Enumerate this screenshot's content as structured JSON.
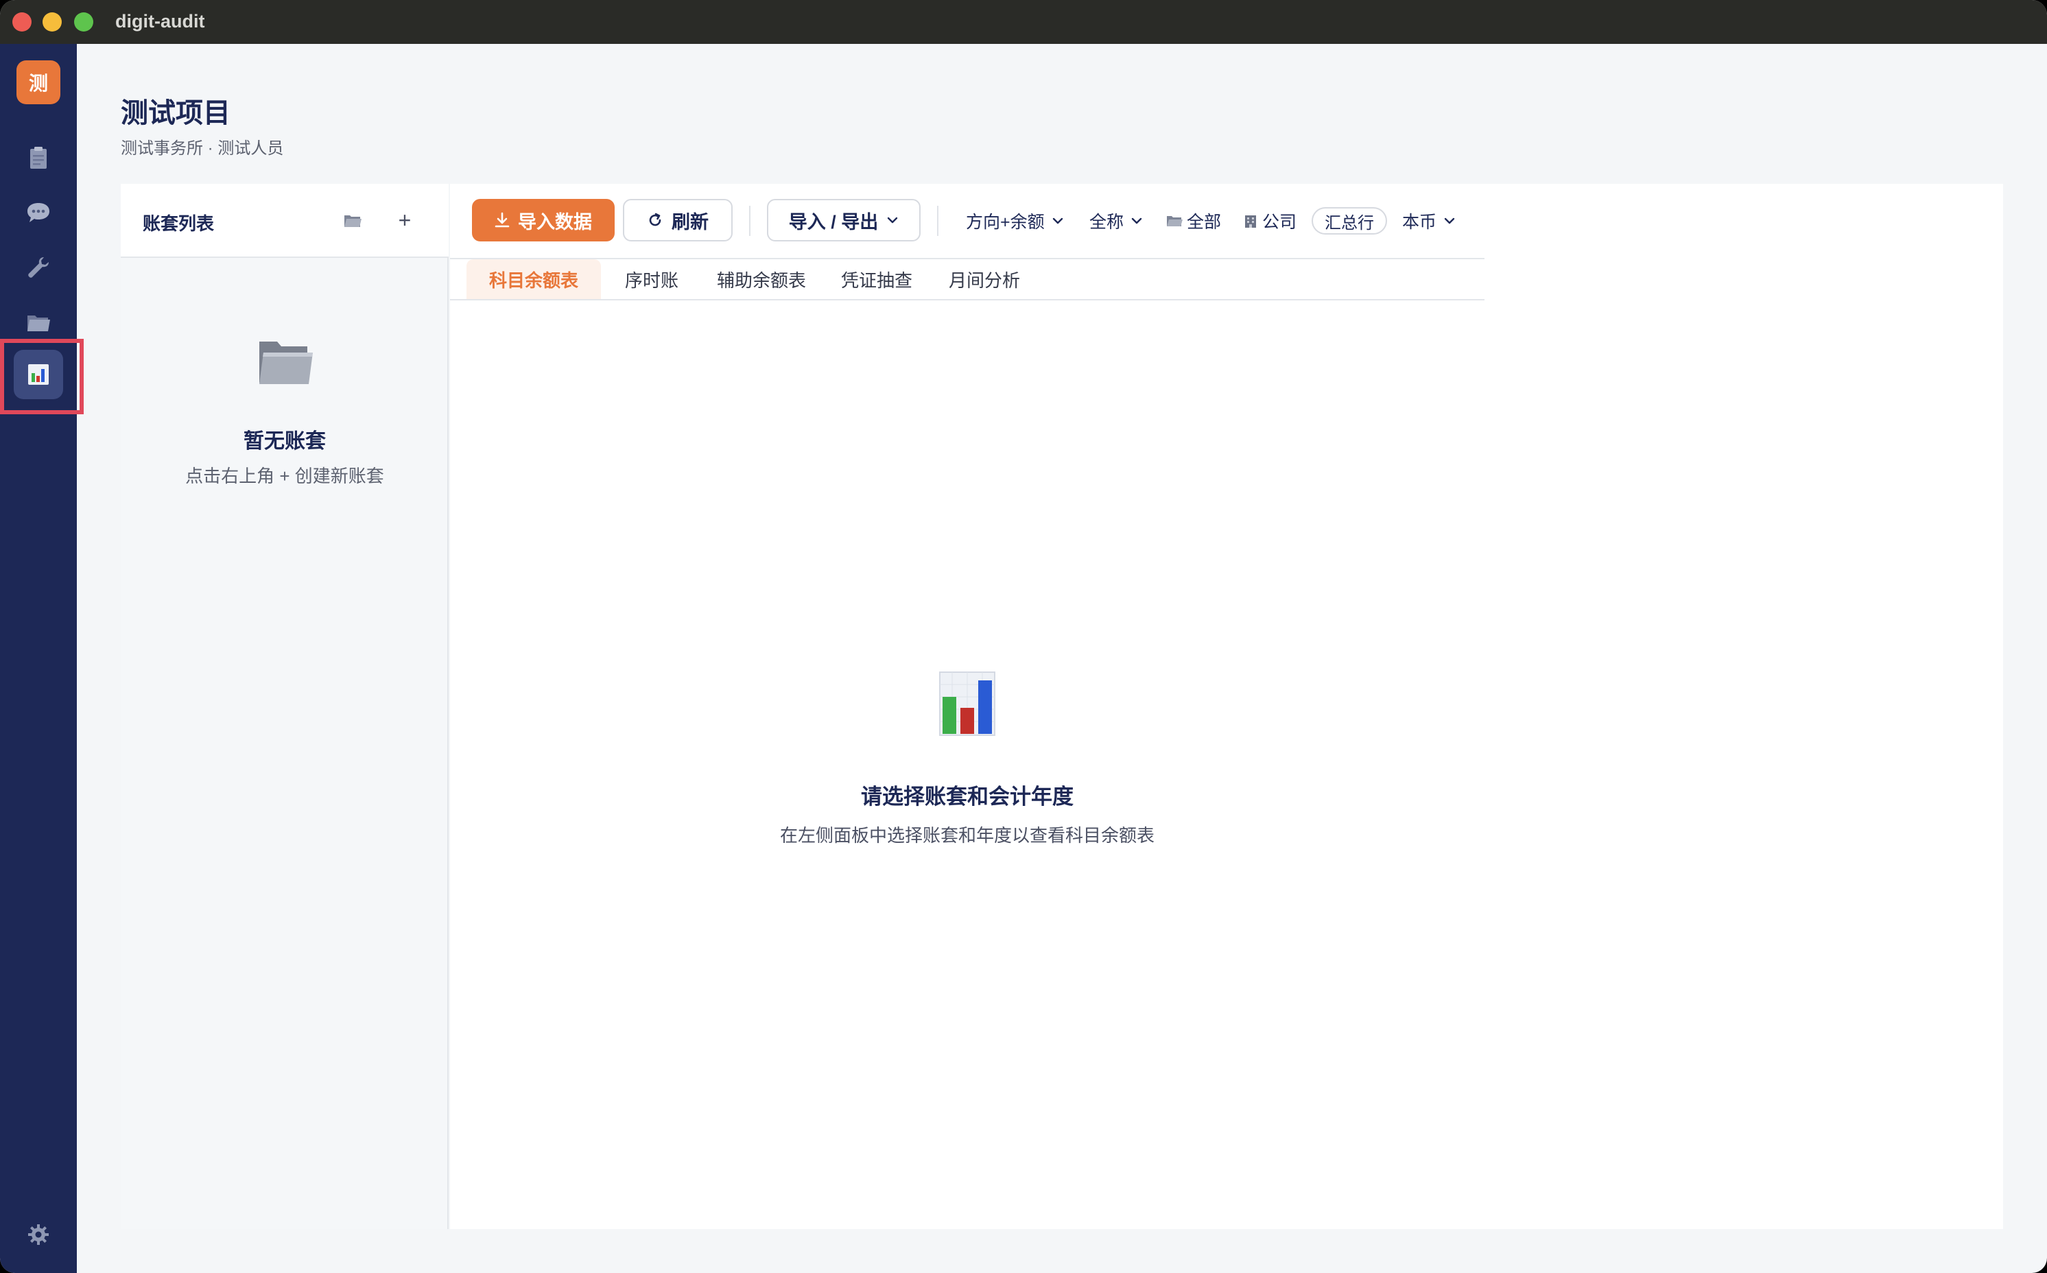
{
  "window": {
    "title": "digit-audit"
  },
  "rail": {
    "logo_text": "测",
    "items": [
      {
        "name": "clipboard-icon"
      },
      {
        "name": "chat-icon"
      },
      {
        "name": "wrench-icon"
      },
      {
        "name": "folder-icon"
      },
      {
        "name": "bar-chart-icon",
        "active": true
      }
    ],
    "settings_icon": "gear-icon"
  },
  "header": {
    "title": "测试项目",
    "subtitle": "测试事务所 · 测试人员"
  },
  "ledger_panel": {
    "title": "账套列表",
    "add_label": "+",
    "empty_title": "暂无账套",
    "empty_hint": "点击右上角 + 创建新账套"
  },
  "toolbar": {
    "import_label": "导入数据",
    "refresh_label": "刷新",
    "io_label": "导入 / 导出",
    "direction_label": "方向+余额",
    "name_label": "全称",
    "scope_label": "全部",
    "company_label": "公司",
    "total_label": "汇总行",
    "currency_label": "本币"
  },
  "tabs": [
    {
      "label": "科目余额表",
      "active": true
    },
    {
      "label": "序时账"
    },
    {
      "label": "辅助余额表"
    },
    {
      "label": "凭证抽查"
    },
    {
      "label": "月间分析"
    }
  ],
  "main_empty": {
    "title": "请选择账套和会计年度",
    "hint": "在左侧面板中选择账套和年度以查看科目余额表"
  },
  "colors": {
    "accent": "#e8773a",
    "rail": "#1d2856",
    "titlebar": "#2a2b27",
    "highlight": "#e0485a"
  }
}
